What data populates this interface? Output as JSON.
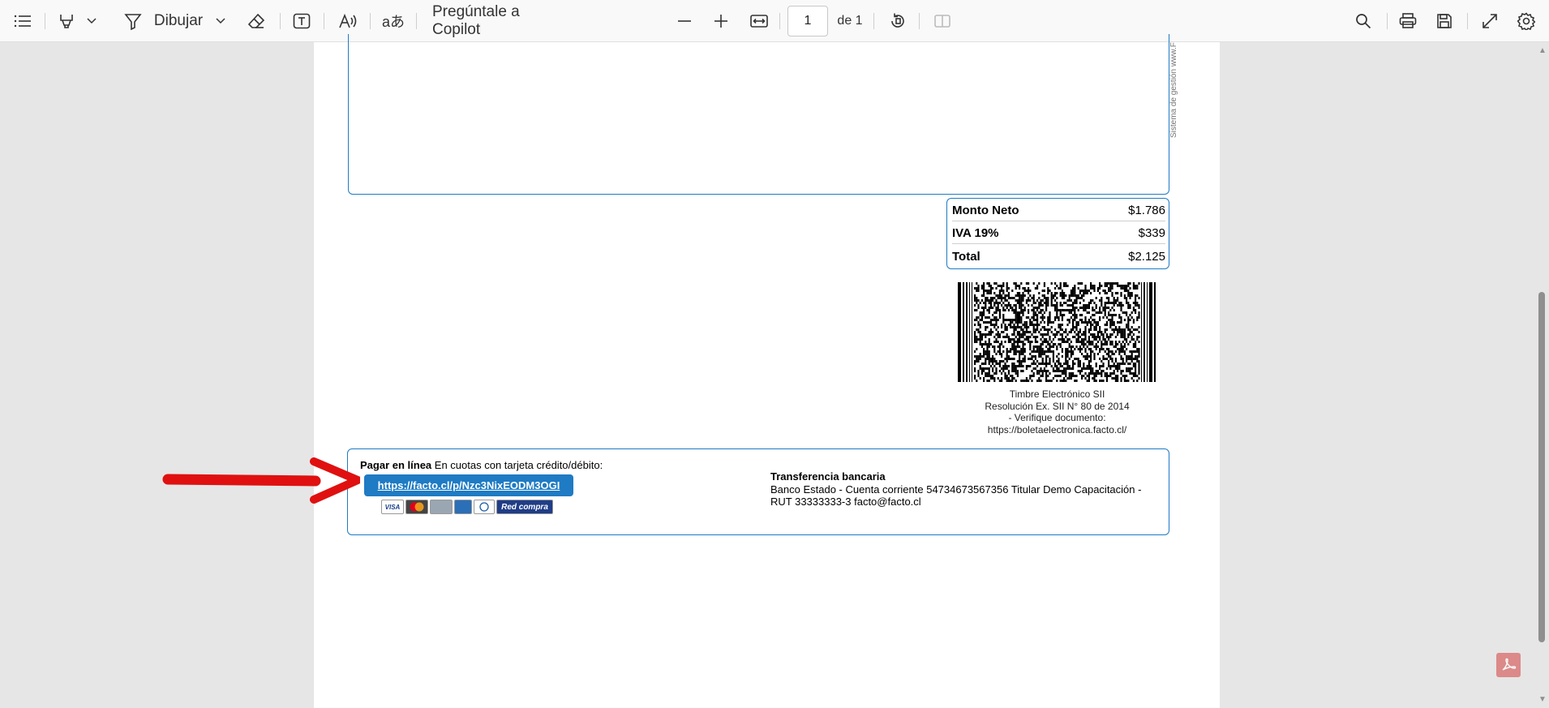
{
  "toolbar": {
    "draw_label": "Dibujar",
    "copilot_label": "Pregúntale a Copilot",
    "page_current": "1",
    "page_total": "de 1"
  },
  "document": {
    "side_text": "Sistema de gestión www.F",
    "totals": [
      {
        "label": "Monto Neto",
        "value": "$1.786"
      },
      {
        "label": "IVA 19%",
        "value": "$339"
      },
      {
        "label": "Total",
        "value": "$2.125"
      }
    ],
    "timbre": {
      "line1": "Timbre Electrónico SII",
      "line2": "Resolución Ex. SII N° 80 de 2014",
      "line3": "- Verifique documento:",
      "line4": "https://boletaelectronica.facto.cl/"
    },
    "payment": {
      "title_bold": "Pagar en línea",
      "title_rest": "En cuotas con tarjeta crédito/débito:",
      "link": "https://facto.cl/p/Nzc3NixEODM3OGI",
      "cards": [
        "VISA",
        "",
        "",
        "",
        "",
        "Red compra"
      ]
    },
    "transfer": {
      "title": "Transferencia bancaria",
      "line1": "Banco Estado - Cuenta corriente 54734673567356 Titular Demo Capacitación -",
      "line2": "RUT 33333333-3 facto@facto.cl"
    }
  },
  "colors": {
    "accent": "#1e7bc4",
    "arrow": "#e01010"
  }
}
